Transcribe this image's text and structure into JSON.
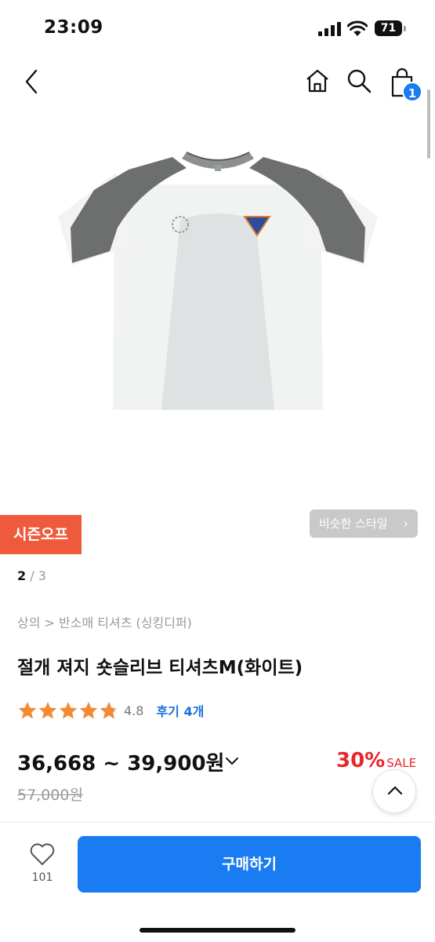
{
  "status_bar": {
    "time": "23:09",
    "battery": "71"
  },
  "nav": {
    "cart_count": "1"
  },
  "product": {
    "season_badge": "시즌오프",
    "similar_style": "비슷한 스타일",
    "image_page_current": "2",
    "image_page_separator": " / ",
    "image_page_total": "3",
    "breadcrumb": "상의 > 반소매 티셔츠 (싱킹디퍼)",
    "title": "절개 져지 숏슬리브 티셔츠M(화이트)",
    "rating": "4.8",
    "rating_stars": 4.8,
    "review_label": "후기 4개",
    "price_range": "36,668 ~ 39,900원",
    "discount_rate": "30%",
    "sale_label": "SALE",
    "original_price": "57,000원"
  },
  "bottom_bar": {
    "wish_count": "101",
    "buy_label": "구매하기"
  },
  "colors": {
    "accent_blue": "#1a7cf2",
    "season_orange": "#ef5a3c",
    "sale_red": "#e8262b",
    "star_orange": "#f28b35"
  },
  "icons": [
    "back-icon",
    "home-icon",
    "search-icon",
    "cart-icon",
    "star-icon",
    "chevron-down-icon",
    "chevron-up-icon",
    "heart-icon"
  ]
}
